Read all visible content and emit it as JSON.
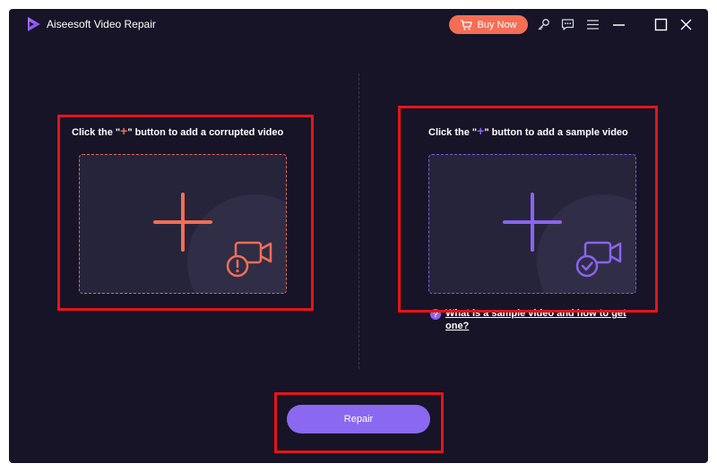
{
  "window": {
    "title": "Aiseesoft Video Repair",
    "logo_icon": "play-logo-icon"
  },
  "titlebar": {
    "buy_label": "Buy Now",
    "buy_icon": "cart-icon",
    "key_icon": "key-icon",
    "feedback_icon": "chat-icon",
    "menu_icon": "menu-icon",
    "minimize_icon": "minimize-icon",
    "maximize_icon": "maximize-icon",
    "close_icon": "close-icon"
  },
  "left_panel": {
    "title_before": "Click the \"",
    "title_plus": "+",
    "title_after": "\" button to add a corrupted video",
    "plus_icon": "plus-icon",
    "badge_icon": "video-warning-icon",
    "accent": "#f36e55"
  },
  "right_panel": {
    "title_before": "Click the \"",
    "title_plus": "+",
    "title_after": "\" button to add a sample video",
    "plus_icon": "plus-icon",
    "badge_icon": "video-check-icon",
    "accent": "#8a63f0",
    "help_glyph": "?",
    "help_text": "What is a sample video and how to get one?"
  },
  "footer": {
    "repair_label": "Repair"
  },
  "colors": {
    "background": "#161426",
    "panel": "#26243a",
    "highlight": "#e5141a",
    "button": "#8b68f0"
  }
}
